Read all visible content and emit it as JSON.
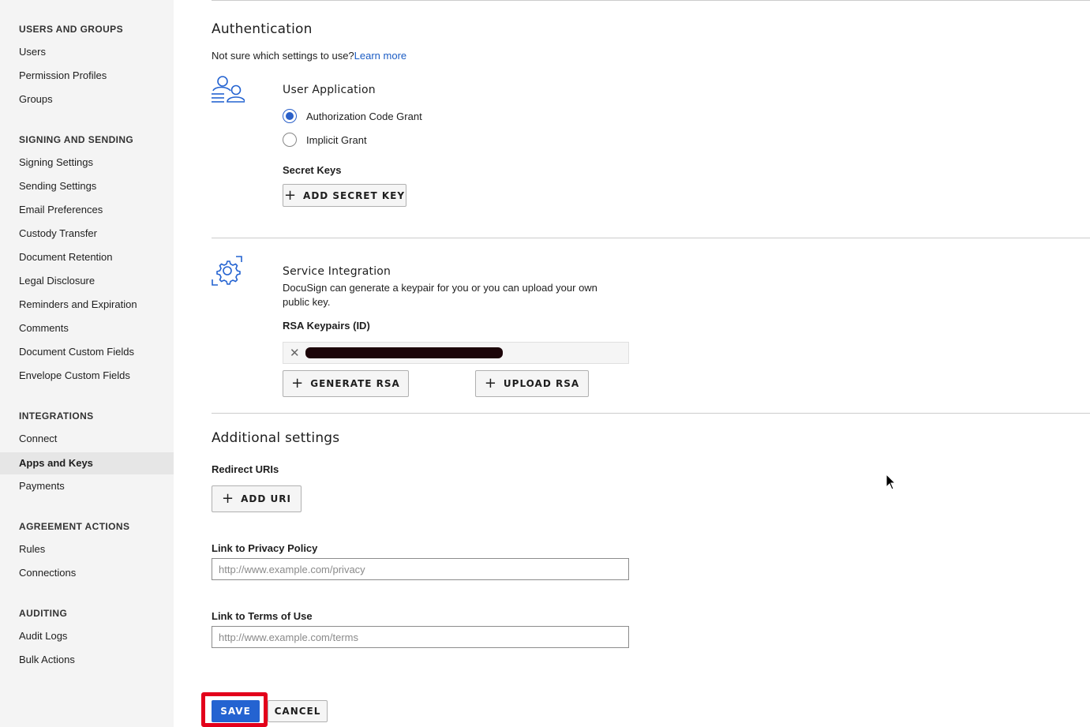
{
  "sidebar": {
    "sections": [
      {
        "heading": "USERS AND GROUPS",
        "items": [
          "Users",
          "Permission Profiles",
          "Groups"
        ]
      },
      {
        "heading": "SIGNING AND SENDING",
        "items": [
          "Signing Settings",
          "Sending Settings",
          "Email Preferences",
          "Custody Transfer",
          "Document Retention",
          "Legal Disclosure",
          "Reminders and Expiration",
          "Comments",
          "Document Custom Fields",
          "Envelope Custom Fields"
        ]
      },
      {
        "heading": "INTEGRATIONS",
        "items": [
          "Connect",
          "Apps and Keys",
          "Payments"
        ]
      },
      {
        "heading": "AGREEMENT ACTIONS",
        "items": [
          "Rules",
          "Connections"
        ]
      },
      {
        "heading": "AUDITING",
        "items": [
          "Audit Logs",
          "Bulk Actions"
        ]
      }
    ],
    "active_item": "Apps and Keys"
  },
  "authentication": {
    "title": "Authentication",
    "help_text": "Not sure which settings to use?",
    "learn_more": "Learn more",
    "user_application": {
      "title": "User Application",
      "options": [
        "Authorization Code Grant",
        "Implicit Grant"
      ],
      "selected": "Authorization Code Grant",
      "secret_keys_label": "Secret Keys",
      "add_secret_key": "ADD SECRET KEY"
    },
    "service_integration": {
      "title": "Service Integration",
      "description": "DocuSign can generate a keypair for you or you can upload your own public key.",
      "rsa_label": "RSA Keypairs (ID)",
      "generate_rsa": "GENERATE RSA",
      "upload_rsa": "UPLOAD RSA"
    }
  },
  "additional": {
    "title": "Additional settings",
    "redirect_label": "Redirect URIs",
    "add_uri": "ADD URI",
    "privacy_label": "Link to Privacy Policy",
    "privacy_placeholder": "http://www.example.com/privacy",
    "terms_label": "Link to Terms of Use",
    "terms_placeholder": "http://www.example.com/terms"
  },
  "actions": {
    "save": "SAVE",
    "cancel": "CANCEL"
  },
  "colors": {
    "accent": "#2463d1",
    "highlight": "#e3001b",
    "link": "#1b5cc4"
  }
}
